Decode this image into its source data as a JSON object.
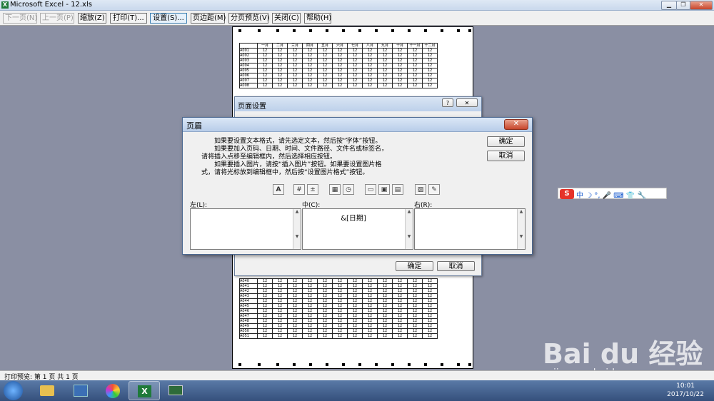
{
  "window": {
    "title": "Microsoft Excel - 12.xls",
    "app_icon": "excel-icon"
  },
  "toolbar": {
    "next_page": "下一页(N)",
    "prev_page": "上一页(P)",
    "zoom": "缩放(Z)",
    "print": "打印(T)...",
    "setup": "设置(S)...",
    "margins": "页边距(M)",
    "page_break": "分页预览(V)",
    "close": "关闭(C)",
    "help": "帮助(H)"
  },
  "sheet": {
    "months": [
      "一月",
      "二月",
      "三月",
      "四月",
      "五月",
      "六月",
      "七月",
      "八月",
      "九月",
      "十月",
      "十一月",
      "十二月"
    ],
    "cell_value": "12",
    "top_rows": [
      "A001",
      "A002",
      "A003",
      "A004",
      "A005",
      "A006",
      "A007",
      "A008"
    ],
    "bottom_rows": [
      "A040",
      "A041",
      "A042",
      "A043",
      "A044",
      "A045",
      "A046",
      "A047",
      "A048",
      "A049",
      "A050",
      "A051"
    ]
  },
  "page_setup": {
    "title": "页面设置",
    "ok": "确定",
    "cancel": "取消"
  },
  "header_dialog": {
    "title": "页眉",
    "close": "✕",
    "instructions": [
      "如果要设置文本格式，请先选定文本，然后按“字体”按钮。",
      "如果要加入页码、日期、时间、文件路径、文件名或标签名，",
      "请将插入点移至编辑框内，然后选择相应按钮。",
      "如果要插入图片，请按“插入图片”按钮。如果要设置图片格",
      "式，请将光标放到编辑框中，然后按“设置图片格式”按钮。"
    ],
    "ok": "确定",
    "cancel": "取消",
    "left_label": "左(L):",
    "center_label": "中(C):",
    "right_label": "右(R):",
    "center_value": "&[日期]"
  },
  "ime": {
    "logo": "S",
    "text": "中 ☽ °, 🎤 ⌨ 👕 🔧"
  },
  "status": {
    "text": "打印预览: 第 1 页  共 1 页"
  },
  "taskbar": {
    "time": "10:01",
    "date": "2017/10/22"
  },
  "watermark": {
    "brand": "Bai du 经验",
    "url": "jingyan.baidu.com"
  }
}
